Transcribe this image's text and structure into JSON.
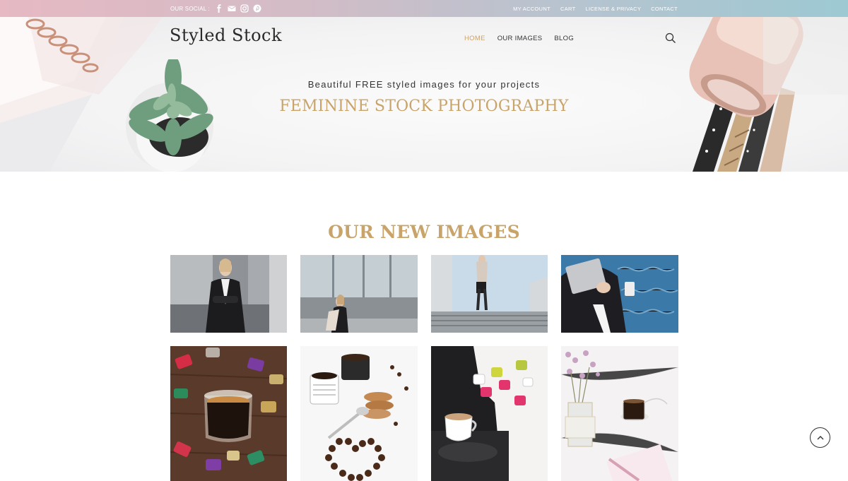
{
  "topbar": {
    "social_label": "OUR SOCIAL :",
    "social_icons": [
      "facebook-icon",
      "email-icon",
      "instagram-icon",
      "pinterest-icon"
    ],
    "links": [
      "MY ACCOUNT",
      "CART",
      "LICENSE & PRIVACY",
      "CONTACT"
    ]
  },
  "header": {
    "logo": "Styled Stock",
    "nav": [
      "HOME",
      "OUR IMAGES",
      "BLOG"
    ],
    "active_nav": "HOME",
    "search_icon": "search-icon"
  },
  "hero": {
    "tagline": "Beautiful FREE styled images for your projects",
    "title": "FEMININE STOCK PHOTOGRAPHY"
  },
  "section": {
    "title": "OUR NEW IMAGES"
  },
  "images": [
    "woman in black blazer with arms crossed",
    "woman holding coffee outside glass building",
    "woman walking on outdoor steps",
    "woman holding tablet and coffee by water",
    "espresso glass among colorful coffee capsules",
    "coffee cups, cookies and coffee-bean heart",
    "espresso machine with cup and capsules",
    "dried flowers, coffee and notebook on marble"
  ],
  "colors": {
    "accent_gold": "#c9a46a",
    "topbar_gradient": [
      "#e6b9c3",
      "#9dc9d3"
    ]
  },
  "scroll_top_icon": "chevron-up-icon"
}
